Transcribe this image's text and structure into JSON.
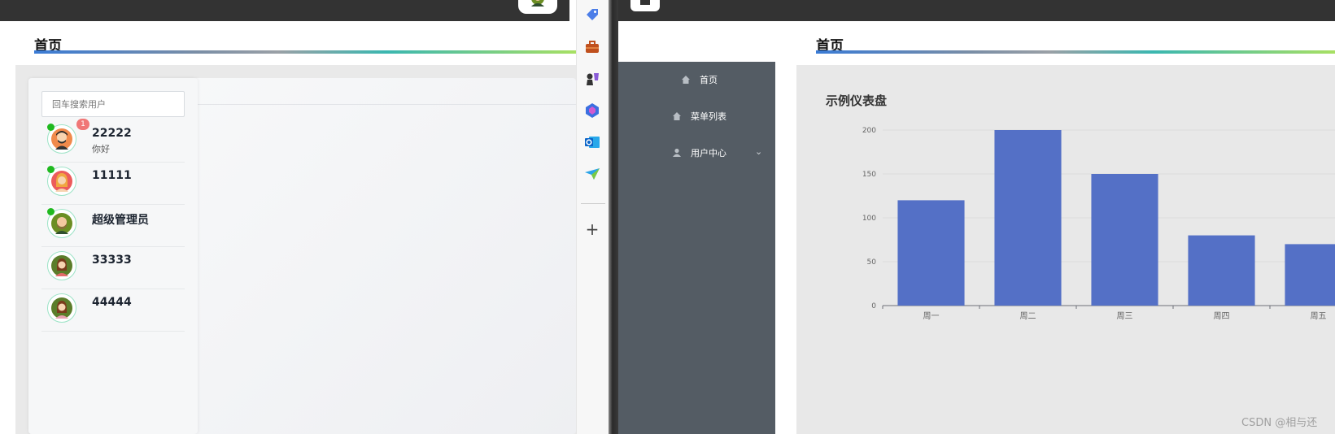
{
  "left_app": {
    "page_title": "首页",
    "search": {
      "placeholder": "回车搜索用户",
      "value": ""
    },
    "users": [
      {
        "name": "22222",
        "message": "你好",
        "online": true,
        "unread": "1"
      },
      {
        "name": "11111",
        "message": "",
        "online": true,
        "unread": ""
      },
      {
        "name": "超级管理员",
        "message": "",
        "online": true,
        "unread": ""
      },
      {
        "name": "33333",
        "message": "",
        "online": false,
        "unread": ""
      },
      {
        "name": "44444",
        "message": "",
        "online": false,
        "unread": ""
      }
    ]
  },
  "side_toolbar": {
    "icons": [
      "tag-icon",
      "briefcase-icon",
      "chess-icon",
      "copilot-icon",
      "outlook-icon",
      "paper-plane-icon"
    ],
    "add_label": "+"
  },
  "right_app": {
    "page_title": "首页",
    "menu": [
      {
        "label": "首页",
        "icon": "home-icon"
      },
      {
        "label": "菜单列表",
        "icon": "home-icon"
      },
      {
        "label": "用户中心",
        "icon": "user-icon",
        "has_submenu": true
      }
    ],
    "chevron": "⌄",
    "dashboard_title": "示例仪表盘"
  },
  "chart_data": {
    "type": "bar",
    "title": "示例仪表盘",
    "categories": [
      "周一",
      "周二",
      "周三",
      "周四",
      "周五"
    ],
    "values": [
      120,
      200,
      150,
      80,
      70
    ],
    "ylim": [
      0,
      200
    ],
    "yticks": [
      0,
      50,
      100,
      150,
      200
    ],
    "bar_color": "#5470c6",
    "grid": true
  },
  "colors": {
    "topbar": "#333333",
    "sidebar": "#545c64",
    "online": "#1fb91f",
    "badge": "#f07777"
  },
  "watermark": "CSDN @相与还"
}
